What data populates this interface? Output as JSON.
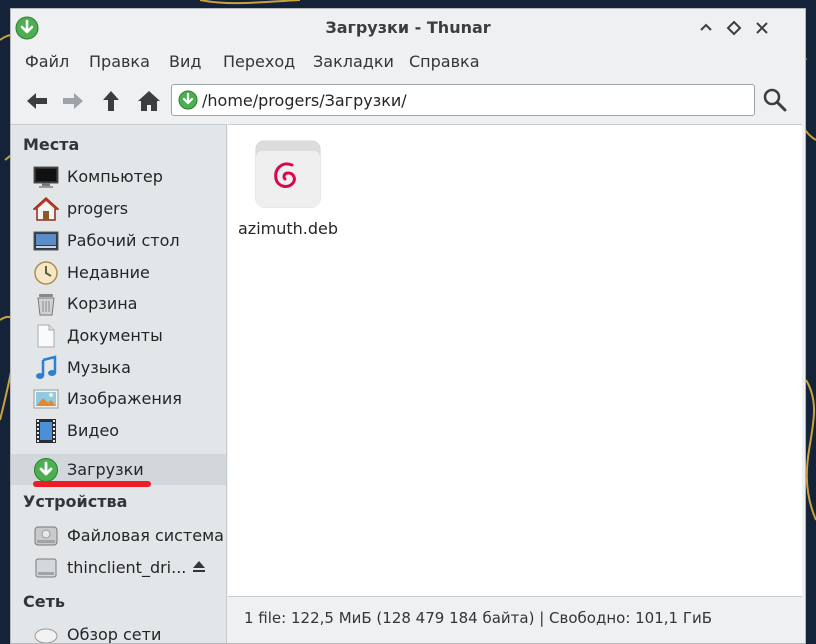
{
  "window": {
    "title": "Загрузки - Thunar",
    "accent": "#4caf50"
  },
  "menu": [
    "Файл",
    "Правка",
    "Вид",
    "Переход",
    "Закладки",
    "Справка"
  ],
  "toolbar": {
    "icons": [
      "back-arrow-icon",
      "forward-arrow-icon",
      "up-arrow-icon",
      "home-icon",
      "search-icon"
    ]
  },
  "location": {
    "path": "/home/progers/Загрузки/"
  },
  "sidebar": {
    "places_header": "Места",
    "places": [
      {
        "label": "Компьютер",
        "icon": "computer-icon"
      },
      {
        "label": "progers",
        "icon": "home-folder-icon"
      },
      {
        "label": "Рабочий стол",
        "icon": "desktop-icon"
      },
      {
        "label": "Недавние",
        "icon": "recent-clock-icon"
      },
      {
        "label": "Корзина",
        "icon": "trash-icon"
      },
      {
        "label": "Документы",
        "icon": "documents-icon"
      },
      {
        "label": "Музыка",
        "icon": "music-icon"
      },
      {
        "label": "Изображения",
        "icon": "pictures-icon"
      },
      {
        "label": "Видео",
        "icon": "video-icon"
      },
      {
        "label": "Загрузки",
        "icon": "downloads-icon",
        "active": true
      }
    ],
    "devices_header": "Устройства",
    "devices": [
      {
        "label": "Файловая система",
        "icon": "drive-icon"
      },
      {
        "label": "thinclient_dri...",
        "icon": "removable-drive-icon"
      }
    ],
    "network_header": "Сеть",
    "network": [
      {
        "label": "Обзор сети",
        "icon": "network-icon"
      }
    ]
  },
  "files": [
    {
      "name": "azimuth.deb",
      "icon": "debian-package-icon"
    }
  ],
  "status": {
    "text": "1 file: 122,5 МиБ (128 479 184 байта)  |  Свободно: 101,1 ГиБ"
  },
  "colors": {
    "highlight_mark": "#ee1c24",
    "debian_red": "#d70751"
  }
}
